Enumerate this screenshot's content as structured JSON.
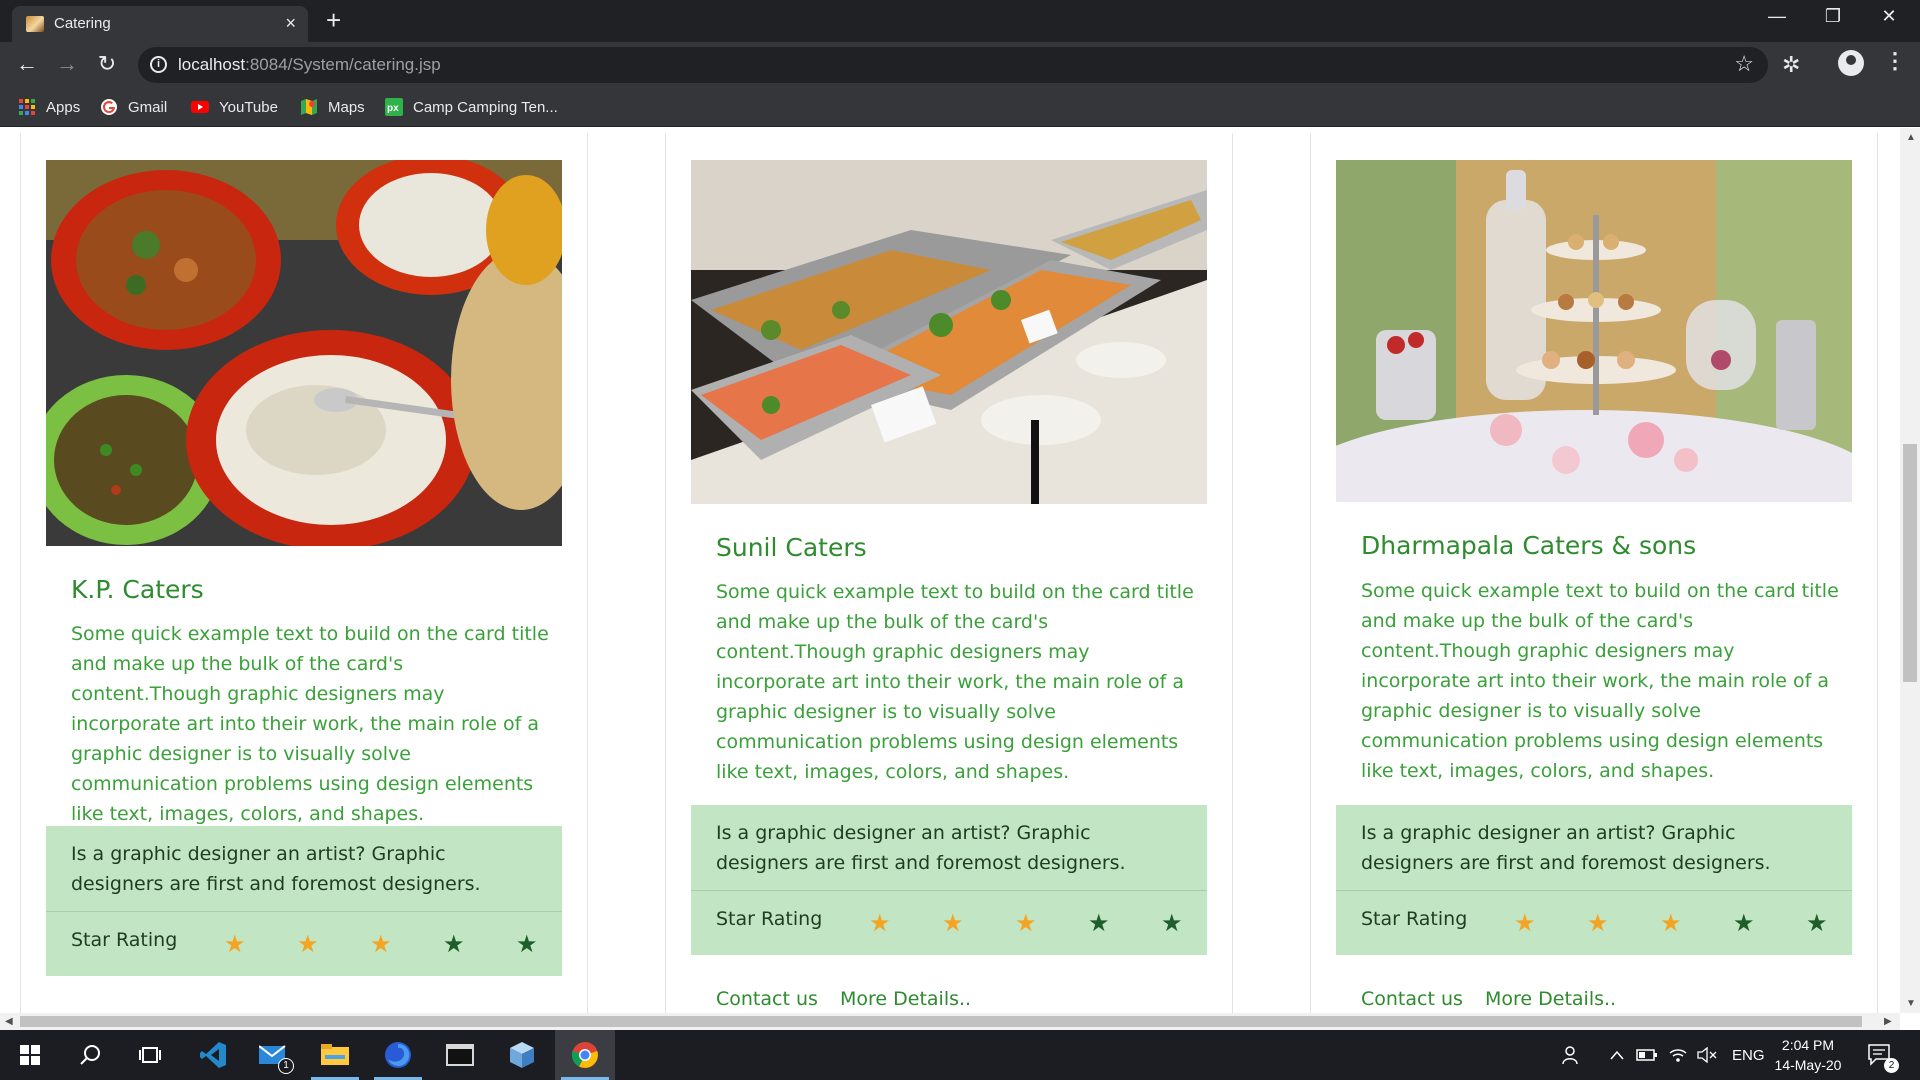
{
  "browser": {
    "tab_title": "Catering",
    "tab_close": "×",
    "new_tab": "+",
    "url_host": "localhost",
    "url_rest": ":8084/System/catering.jsp",
    "window_controls": {
      "minimize": "—",
      "restore": "❐",
      "close": "✕"
    },
    "nav": {
      "back": "←",
      "forward": "→",
      "reload": "↻",
      "info": "i",
      "bookmark_star": "☆",
      "extension": "✲",
      "menu": "⋮"
    }
  },
  "bookmarks": [
    {
      "label": "Apps",
      "icon": "apps-grid-icon"
    },
    {
      "label": "Gmail",
      "icon": "google-icon"
    },
    {
      "label": "YouTube",
      "icon": "youtube-icon"
    },
    {
      "label": "Maps",
      "icon": "maps-icon"
    },
    {
      "label": "Camp Camping Ten...",
      "icon": "px-icon"
    }
  ],
  "cards": [
    {
      "title": "K.P. Caters",
      "text": "Some quick example text to build on the card title and make up the bulk of the card's content.Though graphic designers may incorporate art into their work, the main role of a graphic designer is to visually solve communication problems using design elements like text, images, colors, and shapes.",
      "panel_text": "Is a graphic designer an artist? Graphic designers are first and foremost designers.",
      "rating_label": "Star Rating",
      "rating": 3,
      "max_rating": 5,
      "image": "salad-bowls-photo"
    },
    {
      "title": "Sunil Caters",
      "text": "Some quick example text to build on the card title and make up the bulk of the card's content.Though graphic designers may incorporate art into their work, the main role of a graphic designer is to visually solve communication problems using design elements like text, images, colors, and shapes.",
      "panel_text": "Is a graphic designer an artist? Graphic designers are first and foremost designers.",
      "rating_label": "Star Rating",
      "rating": 3,
      "max_rating": 5,
      "contact_label": "Contact us",
      "details_label": "More Details..",
      "image": "buffet-trays-photo"
    },
    {
      "title": "Dharmapala Caters & sons",
      "text": "Some quick example text to build on the card title and make up the bulk of the card's content.Though graphic designers may incorporate art into their work, the main role of a graphic designer is to visually solve communication problems using design elements like text, images, colors, and shapes.",
      "panel_text": "Is a graphic designer an artist? Graphic designers are first and foremost designers.",
      "rating_label": "Star Rating",
      "rating": 3,
      "max_rating": 5,
      "contact_label": "Contact us",
      "details_label": "More Details..",
      "image": "dessert-table-photo"
    }
  ],
  "star_glyph": "★",
  "colors": {
    "star_filled": "#f4a423",
    "star_empty": "#1d5e2a",
    "accent": "#2e8b2e",
    "panel": "#c2e5c4"
  },
  "taskbar": {
    "items": [
      "windows-start-icon",
      "search-icon",
      "task-view-icon",
      "vscode-icon",
      "mail-icon",
      "file-explorer-icon",
      "firefox-icon",
      "terminal-icon",
      "3d-box-icon",
      "chrome-icon"
    ],
    "mail_badge": "1",
    "language": "ENG",
    "time": "2:04 PM",
    "date": "14-May-20",
    "notification_count": "2"
  }
}
